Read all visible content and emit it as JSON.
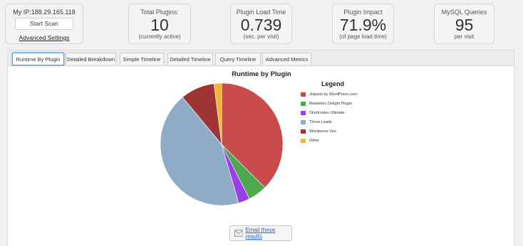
{
  "scanner": {
    "ip_label": "My IP:188.29.165.118",
    "start_scan": "Start Scan",
    "advanced_settings": "Advanced Settings"
  },
  "stats": [
    {
      "label": "Total Plugins:",
      "value": "10",
      "sub": "(currently active)"
    },
    {
      "label": "Plugin Load Time",
      "value": "0.739",
      "sub": "(sec. per visit)"
    },
    {
      "label": "Plugin Impact",
      "value": "71.9%",
      "sub": "(of page load time)"
    },
    {
      "label": "MySQL Queries",
      "value": "95",
      "sub": "per visit"
    }
  ],
  "tabs": [
    "Runtime By Plugin",
    "Detailed Breakdown",
    "Simple Timeline",
    "Detailed Timeline",
    "Query Timeline",
    "Advanced Metrics"
  ],
  "active_tab": "Runtime By Plugin",
  "email_button": "Email these results",
  "chart_data": {
    "type": "pie",
    "title": "Runtime by Plugin",
    "legend_title": "Legend",
    "legend_position": "right",
    "slices": [
      {
        "label": "Jetpack by WordPress.com",
        "value": 37.5,
        "color": "#c94a4a"
      },
      {
        "label": "Marketers Delight Plugin",
        "value": 5.0,
        "color": "#4ea84e"
      },
      {
        "label": "Shortcodes Ultimate",
        "value": 3.0,
        "color": "#9b3ee8"
      },
      {
        "label": "Thrive Leads",
        "value": 43.5,
        "color": "#8eabc8"
      },
      {
        "label": "Wordpress Seo",
        "value": 9.0,
        "color": "#9e3434"
      },
      {
        "label": "Other",
        "value": 2.0,
        "color": "#f2b632"
      }
    ]
  }
}
